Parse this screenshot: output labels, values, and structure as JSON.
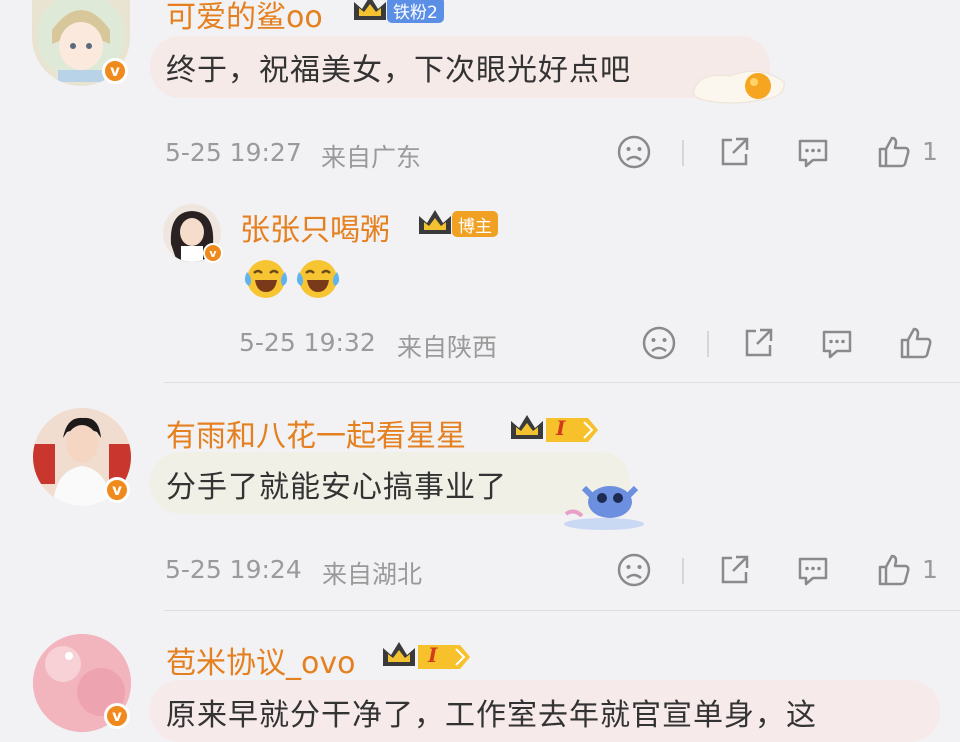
{
  "comments": [
    {
      "username": "可爱的鲨oo",
      "tag": "铁粉2",
      "text": "终于，祝福美女，下次眼光好点吧",
      "time": "5-25 19:27",
      "location": "来自广东",
      "likes": "1",
      "avatar": "anime-boy-avatar"
    },
    {
      "username": "有雨和八花一起看星星",
      "tag": "I",
      "text": "分手了就能安心搞事业了",
      "time": "5-25 19:24",
      "location": "来自湖北",
      "likes": "1",
      "avatar": "man-portrait-avatar"
    },
    {
      "username": "苞米协议_ovo",
      "tag": "I",
      "text": "原来早就分干净了，工作室去年就官宣单身，这",
      "avatar": "pink-avatar"
    }
  ],
  "reply": {
    "username": "张张只喝粥",
    "tag": "博主",
    "emojis": [
      "laugh-cry-emoji",
      "laugh-cry-emoji"
    ],
    "time": "5-25 19:32",
    "location": "来自陕西",
    "avatar": "girl-portrait-avatar"
  },
  "colors": {
    "username": "#e4801f",
    "badge": "#f08a1d",
    "fan_tag": "#5b8fe6",
    "meta": "#9a9a9a"
  }
}
